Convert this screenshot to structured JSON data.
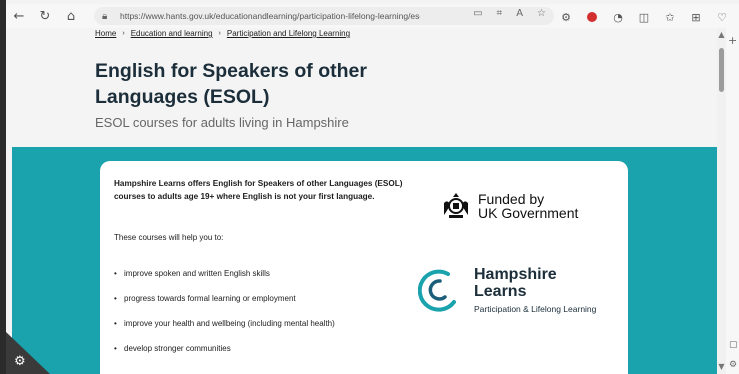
{
  "browser": {
    "url": "https://www.hants.gov.uk/educationandlearning/participation-lifelong-learning/esol",
    "icons": [
      "back-icon",
      "refresh-icon",
      "home-icon",
      "lock-icon",
      "reader-icon",
      "grid-icon",
      "read-aloud-icon",
      "favorite-icon",
      "extension-icon",
      "red-extension-icon",
      "profile-icon",
      "split-icon",
      "favorites-icon",
      "collections-icon",
      "heart-icon"
    ]
  },
  "breadcrumb": {
    "home": "Home",
    "sep": "›",
    "education": "Education and learning",
    "participation": "Participation and Lifelong Learning"
  },
  "page": {
    "title": "English for Speakers of other Languages (ESOL)",
    "subtitle": "ESOL courses for adults living in Hampshire"
  },
  "card": {
    "intro": "Hampshire Learns offers English for Speakers of other Languages (ESOL) courses to adults age 19+ where English is not your first language.",
    "help": "These courses will help you to:",
    "bullets": [
      "improve spoken and written English skills",
      "progress towards formal learning or employment",
      "improve your health and wellbeing (including mental health)",
      "develop stronger communities"
    ]
  },
  "logos": {
    "funded_line1": "Funded by",
    "funded_line2": "UK Government",
    "hl_line1": "Hampshire",
    "hl_line2": "Learns",
    "hl_tagline": "Participation & Lifelong Learning"
  },
  "colors": {
    "teal": "#1aa2ad",
    "title": "#1b2e3a",
    "ring_light": "#1aa2ad",
    "ring_dark": "#1b5e7a"
  }
}
